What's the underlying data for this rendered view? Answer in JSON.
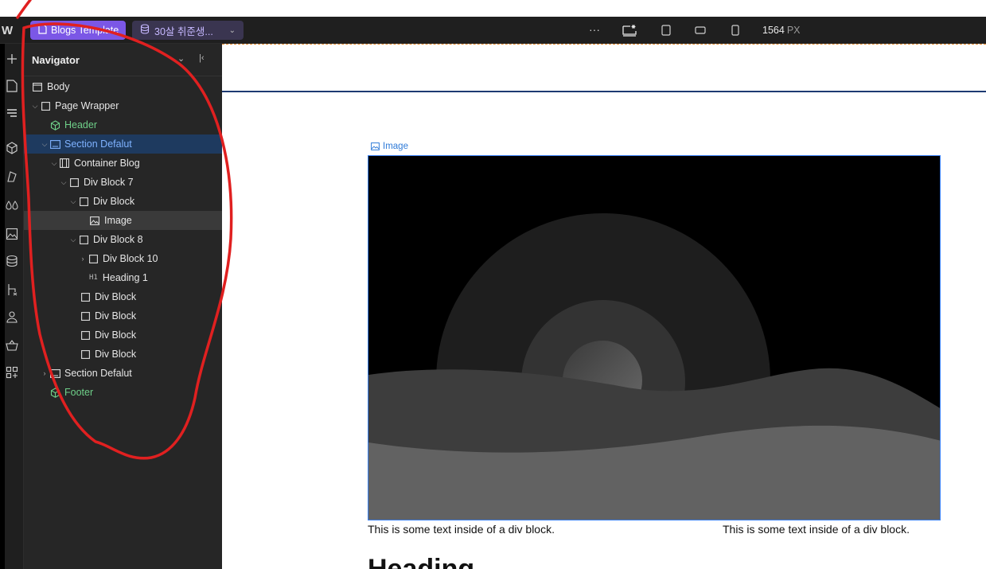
{
  "topbar": {
    "project_pill": "Blogs Template",
    "site_pill": "30살 취준생...",
    "more_label": "···",
    "width_value": "1564",
    "width_unit": "PX"
  },
  "navigator": {
    "title": "Navigator",
    "items": [
      {
        "label": "Body"
      },
      {
        "label": "Page Wrapper"
      },
      {
        "label": "Header"
      },
      {
        "label": "Section Defalut"
      },
      {
        "label": "Container Blog"
      },
      {
        "label": "Div Block 7"
      },
      {
        "label": "Div Block"
      },
      {
        "label": "Image"
      },
      {
        "label": "Div Block 8"
      },
      {
        "label": "Div Block 10"
      },
      {
        "label": "Heading 1",
        "tag": "H1"
      },
      {
        "label": "Div Block"
      },
      {
        "label": "Div Block"
      },
      {
        "label": "Div Block"
      },
      {
        "label": "Div Block"
      },
      {
        "label": "Section Defalut"
      },
      {
        "label": "Footer"
      }
    ]
  },
  "canvas": {
    "image_label": "Image",
    "text_left": "This is some text inside of a div block.",
    "text_right": "This is some text inside of a div block.",
    "heading_partial": "Heading"
  },
  "colors": {
    "selection": "#1e3a5f",
    "component_green": "#6fd089",
    "accent_purple": "#7b57e6",
    "annotation_red": "#e02020"
  }
}
